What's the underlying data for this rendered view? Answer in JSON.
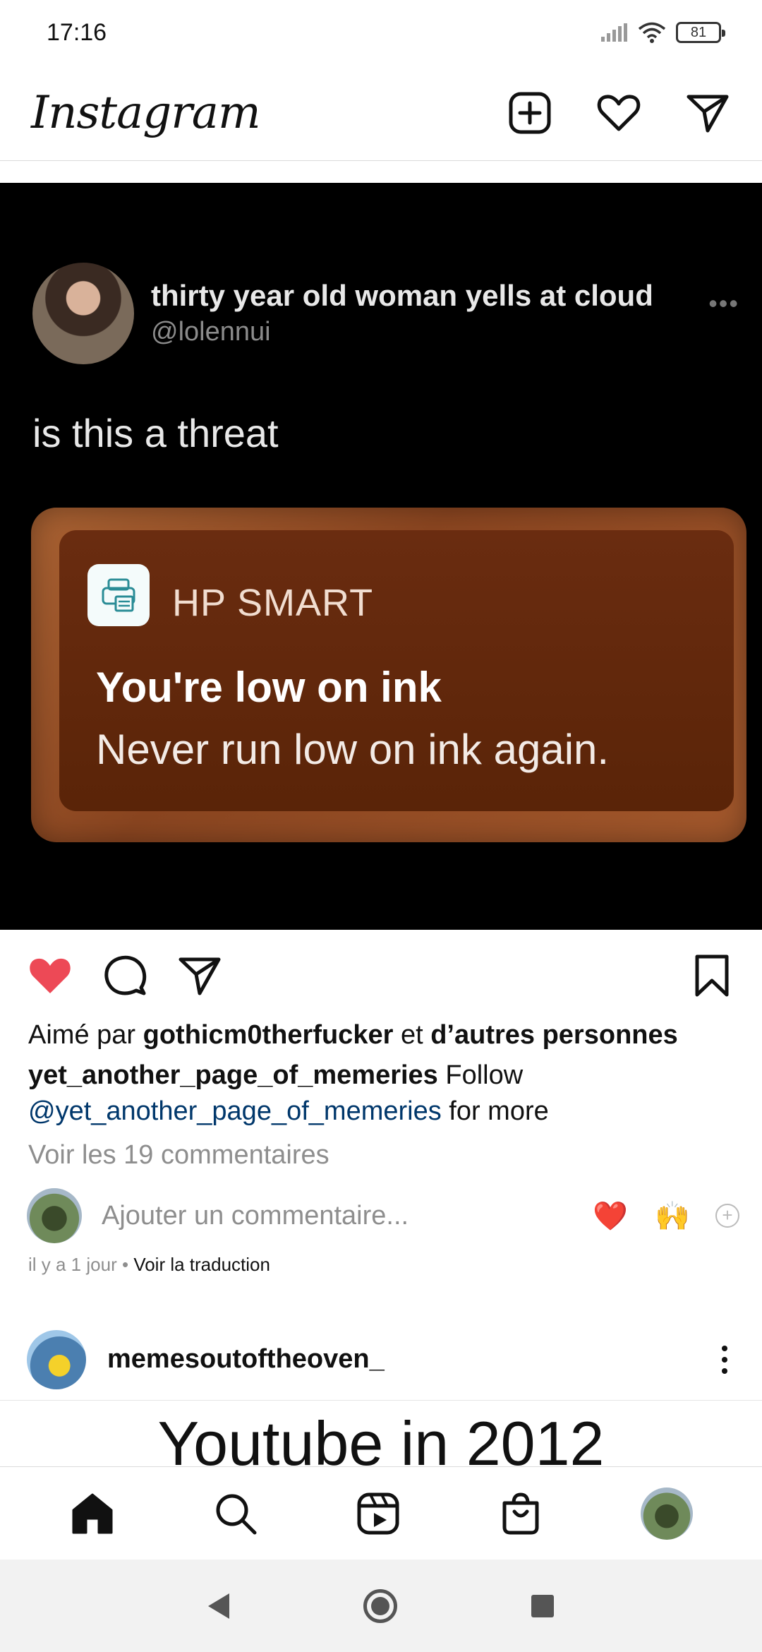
{
  "status_bar": {
    "time": "17:16",
    "battery": "81",
    "icons": [
      "signal-icon",
      "wifi-icon",
      "battery-icon"
    ]
  },
  "header": {
    "logo": "Instagram",
    "icons": [
      "new-post-icon",
      "activity-heart-icon",
      "direct-message-icon"
    ]
  },
  "post": {
    "media": {
      "tweet_name": "thirty year old woman yells at cloud",
      "tweet_handle": "@lolennui",
      "tweet_more": "•••",
      "tweet_text": "is this a threat",
      "notification": {
        "app": "HP SMART",
        "title": "You're low on ink",
        "body": "Never run low on ink again."
      }
    },
    "liked": true,
    "likes_prefix": "Aimé par",
    "likes_user": "gothicm0therfucker",
    "likes_conj": "et",
    "likes_others": "d’autres personnes",
    "caption_user": "yet_another_page_of_memeries",
    "caption_text": "Follow",
    "caption_mention": "@yet_another_page_of_memeries",
    "caption_tail": "for more",
    "view_comments": "Voir les 19 commentaires",
    "comment_placeholder": "Ajouter un commentaire...",
    "quick_emojis": [
      "❤️",
      "🙌"
    ],
    "quick_plus": "+",
    "time_ago": "il y a 1 jour",
    "separator": "•",
    "translate": "Voir la traduction"
  },
  "next_post": {
    "username": "memesoutoftheoven_",
    "media_text": "Youtube in 2012"
  },
  "colors": {
    "like_red": "#ed4956",
    "mention_blue": "#00376b",
    "muted": "#8e8e8e"
  }
}
